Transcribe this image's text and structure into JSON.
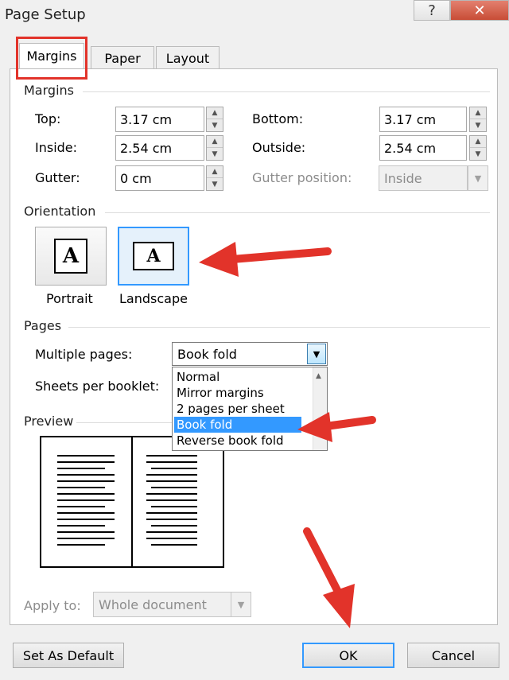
{
  "window": {
    "title": "Page Setup",
    "help_label": "?",
    "close_label": "✕"
  },
  "tabs": [
    {
      "label": "Margins"
    },
    {
      "label": "Paper"
    },
    {
      "label": "Layout"
    }
  ],
  "margins": {
    "group_label": "Margins",
    "top": {
      "label": "Top:",
      "value": "3.17 cm"
    },
    "bottom": {
      "label": "Bottom:",
      "value": "3.17 cm"
    },
    "inside": {
      "label": "Inside:",
      "value": "2.54 cm"
    },
    "outside": {
      "label": "Outside:",
      "value": "2.54 cm"
    },
    "gutter": {
      "label": "Gutter:",
      "value": "0 cm"
    },
    "gutter_position": {
      "label": "Gutter position:",
      "value": "Inside"
    }
  },
  "orientation": {
    "group_label": "Orientation",
    "portrait_label": "Portrait",
    "landscape_label": "Landscape",
    "icon_letter": "A",
    "selected": "Landscape"
  },
  "pages": {
    "group_label": "Pages",
    "multiple_pages_label": "Multiple pages:",
    "multiple_pages_value": "Book fold",
    "sheets_per_booklet_label": "Sheets per booklet:",
    "options": [
      "Normal",
      "Mirror margins",
      "2 pages per sheet",
      "Book fold",
      "Reverse book fold"
    ],
    "highlighted_option": "Book fold"
  },
  "preview": {
    "group_label": "Preview"
  },
  "apply_to": {
    "label": "Apply to:",
    "value": "Whole document"
  },
  "buttons": {
    "set_default": "Set As Default",
    "ok": "OK",
    "cancel": "Cancel"
  },
  "colors": {
    "annotation_red": "#e2332a",
    "selection_blue": "#3399ff"
  }
}
